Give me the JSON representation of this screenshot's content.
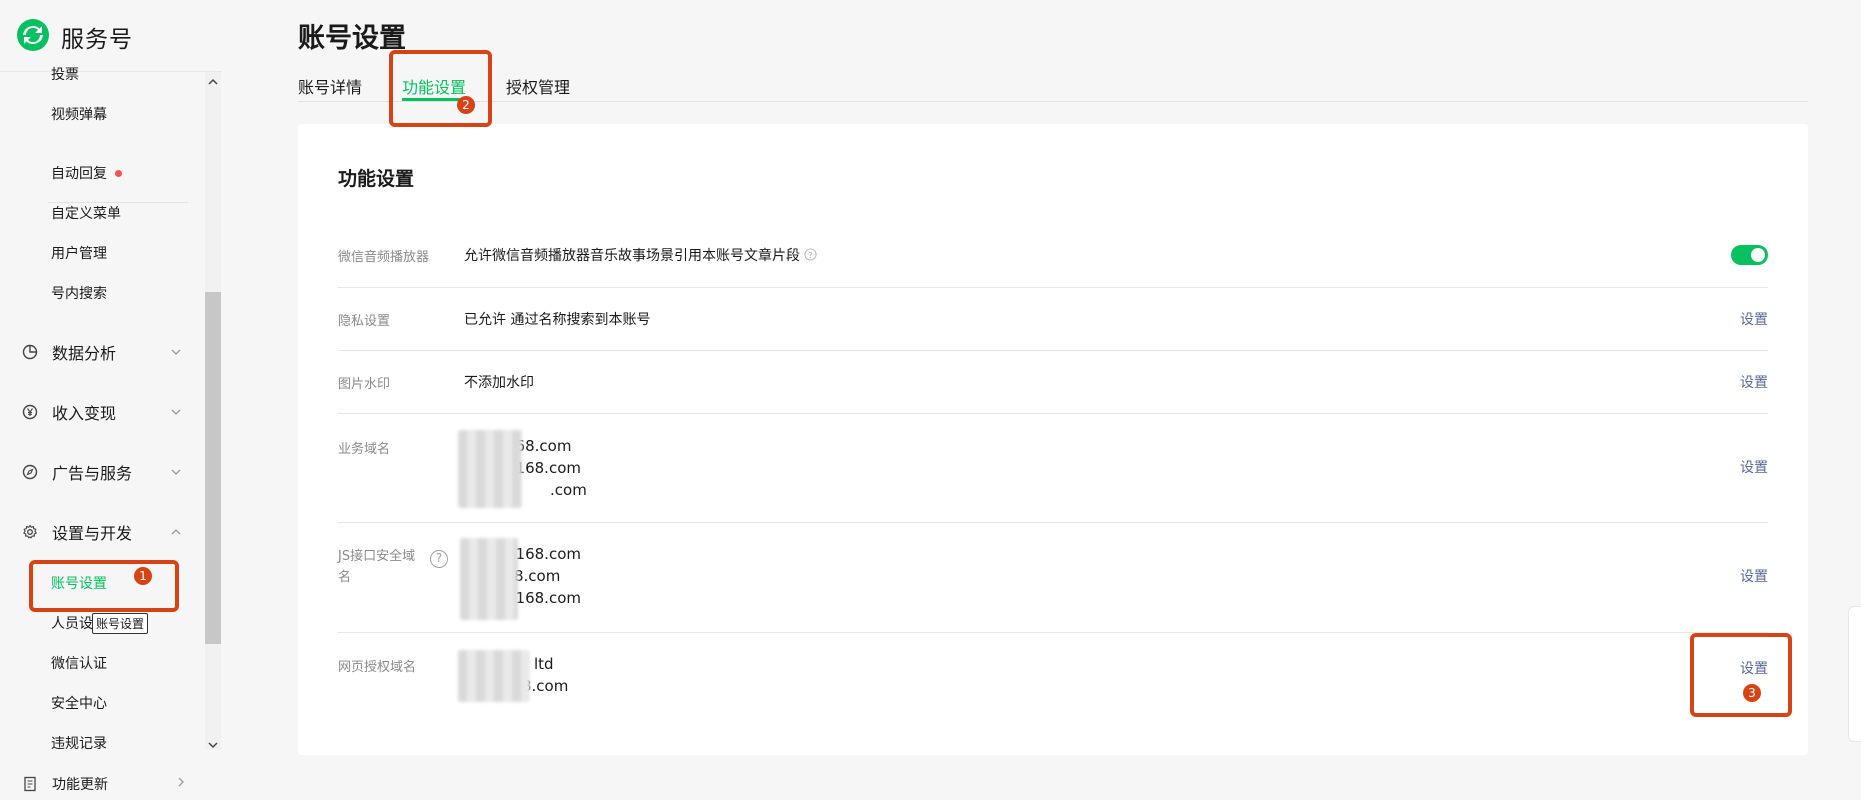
{
  "app": {
    "name": "服务号"
  },
  "sidebar": {
    "items_top": [
      {
        "label": "投票"
      },
      {
        "label": "视频弹幕"
      }
    ],
    "items_mid": [
      {
        "label": "自动回复"
      },
      {
        "label": "自定义菜单"
      },
      {
        "label": "用户管理"
      },
      {
        "label": "号内搜索"
      }
    ],
    "groups": [
      {
        "label": "数据分析",
        "icon": "pie-chart-icon"
      },
      {
        "label": "收入变现",
        "icon": "yen-icon"
      },
      {
        "label": "广告与服务",
        "icon": "compass-icon"
      },
      {
        "label": "设置与开发",
        "icon": "gear-icon"
      }
    ],
    "settings_items": [
      {
        "label": "账号设置"
      },
      {
        "label": "人员设"
      },
      {
        "label": "微信认证"
      },
      {
        "label": "安全中心"
      },
      {
        "label": "违规记录"
      }
    ],
    "bottom": {
      "label": "功能更新"
    },
    "tooltip": "账号设置"
  },
  "annotations": [
    "1",
    "2",
    "3"
  ],
  "main": {
    "title": "账号设置",
    "tabs": [
      {
        "label": "账号详情"
      },
      {
        "label": "功能设置"
      },
      {
        "label": "授权管理"
      }
    ]
  },
  "card": {
    "title": "功能设置",
    "rows": [
      {
        "label": "微信音频播放器",
        "value": "允许微信音频播放器音乐故事场景引用本账号文章片段",
        "control": "toggle-on"
      },
      {
        "label": "隐私设置",
        "value": "已允许 通过名称搜索到本账号",
        "action": "设置"
      },
      {
        "label": "图片水印",
        "value": "不添加水印",
        "action": "设置"
      },
      {
        "label": "业务域名",
        "domains": [
          "168.com",
          "8168.com",
          ".com"
        ],
        "action": "设置"
      },
      {
        "label_line1": "JS接口安全域",
        "label_line2": "名",
        "domains": [
          "8168.com",
          "8.com",
          "3168.com"
        ],
        "action": "设置"
      },
      {
        "label": "网页授权域名",
        "domains": [
          "ltd",
          "8.com"
        ],
        "action": "设置"
      }
    ]
  },
  "colors": {
    "accent": "#07c160",
    "link": "#576b95",
    "annotation": "#d84315",
    "badge": "#fa5151"
  }
}
